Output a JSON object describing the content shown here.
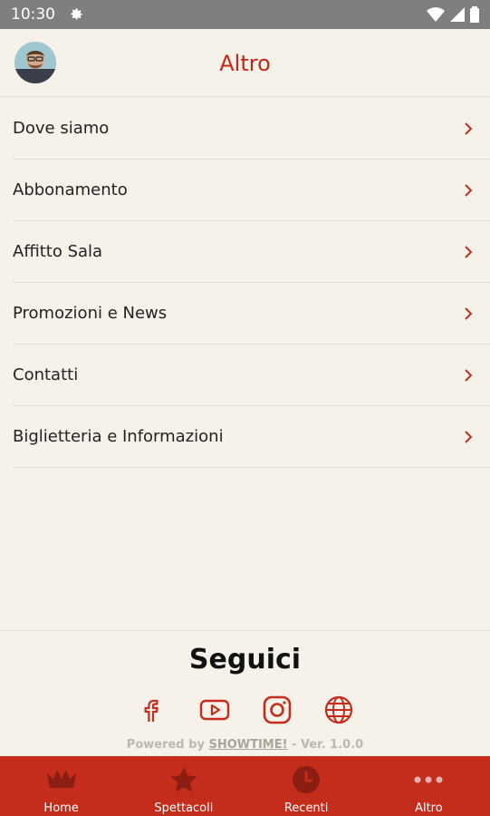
{
  "status_bar": {
    "time": "10:30"
  },
  "header": {
    "title": "Altro"
  },
  "menu": {
    "items": [
      {
        "label": "Dove siamo"
      },
      {
        "label": "Abbonamento"
      },
      {
        "label": "Affitto Sala"
      },
      {
        "label": "Promozioni e News"
      },
      {
        "label": "Contatti"
      },
      {
        "label": "Biglietteria e Informazioni"
      }
    ]
  },
  "follow": {
    "title": "Seguici",
    "socials": [
      "facebook-icon",
      "youtube-icon",
      "instagram-icon",
      "globe-icon"
    ],
    "powered_prefix": "Powered by ",
    "powered_brand": "SHOWTIME!",
    "powered_suffix": " - Ver. 1.0.0"
  },
  "tab_bar": {
    "tabs": [
      {
        "label": "Home",
        "icon": "crown-icon"
      },
      {
        "label": "Spettacoli",
        "icon": "star-icon"
      },
      {
        "label": "Recenti",
        "icon": "clock-icon"
      },
      {
        "label": "Altro",
        "icon": "more-dots-icon"
      }
    ]
  },
  "colors": {
    "accent": "#c42c1c",
    "background": "#f6f2ea",
    "status_bar": "#7f7f7f"
  }
}
